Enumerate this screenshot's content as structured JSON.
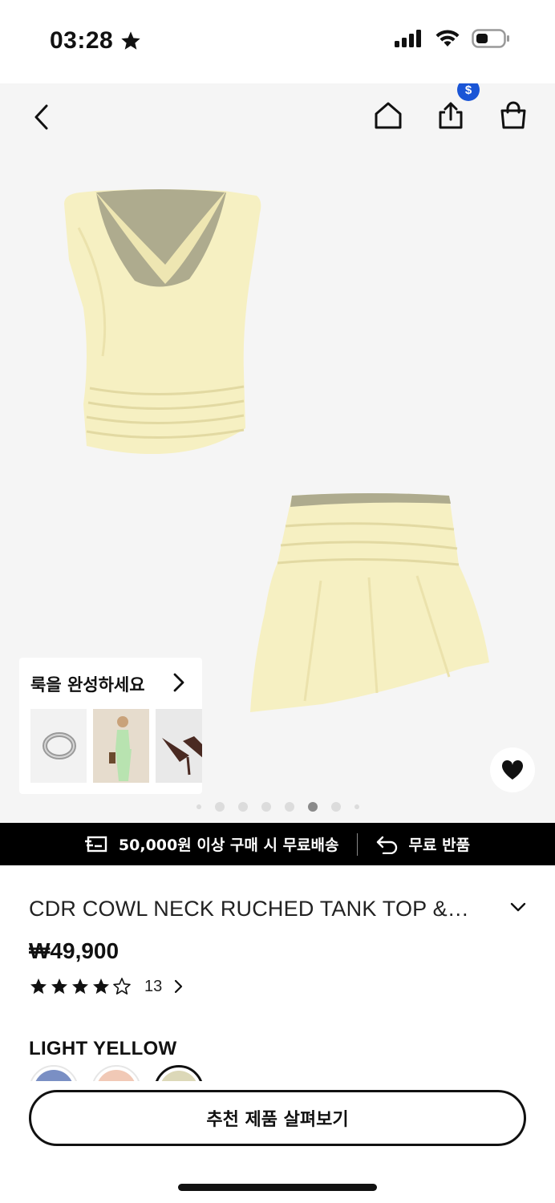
{
  "status_bar": {
    "time": "03:28",
    "badge_symbol": "$"
  },
  "look_card": {
    "title": "룩을 완성하세요"
  },
  "carousel": {
    "total": 8,
    "active_index": 5
  },
  "promo": {
    "shipping_text": "50,000원 이상 구매 시 무료배송",
    "returns_text": "무료 반품"
  },
  "product": {
    "title": "CDR COWL NECK RUCHED TANK TOP &…",
    "price": "₩49,900",
    "rating": 4,
    "rating_max": 5,
    "review_count": "13",
    "color_name": "LIGHT YELLOW",
    "swatches": [
      "#7a8fc4",
      "#f1c9b6",
      "#dcd8b8"
    ],
    "selected_swatch": 2
  },
  "cta": {
    "label": "추천 제품 살펴보기"
  },
  "colors": {
    "accent_blue": "#1a55d6",
    "garment_yellow": "#f6f0c2"
  },
  "icons": {
    "back": "chevron-left-icon",
    "home": "home-icon",
    "share": "share-icon",
    "bag": "shopping-bag-icon",
    "wishlist": "heart-icon",
    "shipping": "delivery-truck-icon",
    "returns": "return-arrow-icon"
  }
}
